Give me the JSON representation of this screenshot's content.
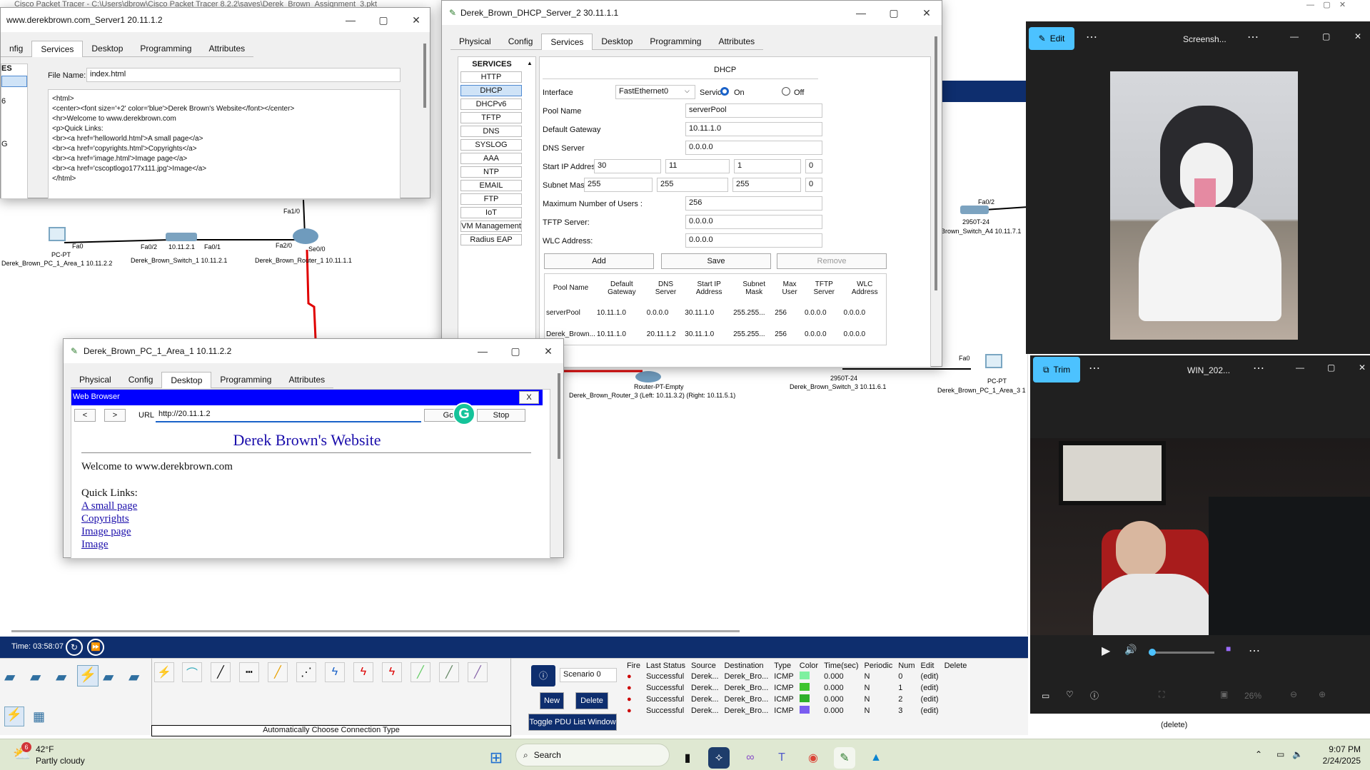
{
  "bg_title": "Cisco Packet Tracer - C:\\Users\\dbrow\\Cisco Packet Tracer 8.2.2\\saves\\Derek_Brown_Assignment_3.pkt",
  "server1": {
    "title": "www.derekbrown.com_Server1 20.11.1.2",
    "tabs": [
      "nfig",
      "Services",
      "Desktop",
      "Programming",
      "Attributes"
    ],
    "side_head": "ES",
    "file_label": "File Name:",
    "file_value": "index.html",
    "code": [
      "<html>",
      "<center><font size='+2' color='blue'>Derek Brown's Website</font></center>",
      "<hr>Welcome to www.derekbrown.com",
      "<p>Quick Links:",
      "<br><a href='helloworld.html'>A small page</a>",
      "<br><a href='copyrights.html'>Copyrights</a>",
      "<br><a href='image.html'>Image page</a>",
      "<br><a href='cscoptlogo177x111.jpg'>Image</a>",
      "</html>"
    ],
    "side_items": [
      "",
      "6",
      "",
      "G"
    ]
  },
  "dhcp": {
    "title": "Derek_Brown_DHCP_Server_2 30.11.1.1",
    "tabs": [
      "Physical",
      "Config",
      "Services",
      "Desktop",
      "Programming",
      "Attributes"
    ],
    "services_head": "SERVICES",
    "services": [
      "HTTP",
      "DHCP",
      "DHCPv6",
      "TFTP",
      "DNS",
      "SYSLOG",
      "AAA",
      "NTP",
      "EMAIL",
      "FTP",
      "IoT",
      "VM Management",
      "Radius EAP"
    ],
    "heading": "DHCP",
    "interface_label": "Interface",
    "interface_value": "FastEthernet0",
    "service_label": "Service",
    "on": "On",
    "off": "Off",
    "pool_label": "Pool Name",
    "pool_value": "serverPool",
    "gw_label": "Default Gateway",
    "gw_value": "10.11.1.0",
    "dns_label": "DNS Server",
    "dns_value": "0.0.0.0",
    "start_label": "Start IP Address :",
    "start_ip": [
      "30",
      "11",
      "1",
      "0"
    ],
    "mask_label": "Subnet Mask:",
    "mask": [
      "255",
      "255",
      "255",
      "0"
    ],
    "max_label": "Maximum Number of Users :",
    "max_value": "256",
    "tftp_label": "TFTP Server:",
    "tftp_value": "0.0.0.0",
    "wlc_label": "WLC Address:",
    "wlc_value": "0.0.0.0",
    "add": "Add",
    "save": "Save",
    "remove": "Remove",
    "table_headers": [
      "Pool Name",
      "Default Gateway",
      "DNS Server",
      "Start IP Address",
      "Subnet Mask",
      "Max User",
      "TFTP Server",
      "WLC Address"
    ],
    "rows": [
      [
        "serverPool",
        "10.11.1.0",
        "0.0.0.0",
        "30.11.1.0",
        "255.255...",
        "256",
        "0.0.0.0",
        "0.0.0.0"
      ],
      [
        "Derek_Brown...",
        "10.11.1.0",
        "20.11.1.2",
        "30.11.1.0",
        "255.255...",
        "256",
        "0.0.0.0",
        "0.0.0.0"
      ]
    ]
  },
  "pc": {
    "title": "Derek_Brown_PC_1_Area_1 10.11.2.2",
    "tabs": [
      "Physical",
      "Config",
      "Desktop",
      "Programming",
      "Attributes"
    ],
    "browser_title": "Web Browser",
    "close": "X",
    "back": "<",
    "fwd": ">",
    "url_label": "URL",
    "url": "http://20.11.1.2",
    "go": "Go",
    "stop": "Stop",
    "page_title": "Derek Brown's Website",
    "welcome": "Welcome to www.derekbrown.com",
    "quick": "Quick Links:",
    "links": [
      "A small page",
      "Copyrights",
      "Image page",
      "Image"
    ]
  },
  "topology": {
    "nodes": [
      {
        "t": "Fa1/0"
      },
      {
        "t": "Fa0"
      },
      {
        "t": "Fa0/2"
      },
      {
        "t": "Fa0/1"
      },
      {
        "t": "10.11.2.1"
      },
      {
        "t": "Fa2/0"
      },
      {
        "t": "Se0/0"
      },
      {
        "t": "PC-PT"
      },
      {
        "t": "Derek_Brown_PC_1_Area_1 10.11.2.2"
      },
      {
        "t": "Derek_Brown_Switch_1 10.11.2.1"
      },
      {
        "t": "Derek_Brown_Router_1 10.11.1.1"
      },
      {
        "t": "Fa0/2"
      },
      {
        "t": "2950T-24"
      },
      {
        "t": "Brown_Switch_A4 10.11.7.1"
      },
      {
        "t": "Router-PT-Empty"
      },
      {
        "t": "Derek_Brown_Router_3 (Left: 10.11.3.2) (Right: 10.11.5.1)"
      },
      {
        "t": "2950T-24"
      },
      {
        "t": "Derek_Brown_Switch_3 10.11.6.1"
      },
      {
        "t": "Fa0"
      },
      {
        "t": "PC-PT"
      },
      {
        "t": "Derek_Brown_PC_1_Area_3 1"
      }
    ]
  },
  "photo1": {
    "edit": "Edit",
    "title": "Screensh..."
  },
  "video": {
    "trim": "Trim",
    "title": "WIN_202...",
    "zoom": "26%"
  },
  "pt": {
    "time": "Time: 03:58:07",
    "conn_type": "Automatically Choose Connection Type",
    "scenario": "Scenario 0",
    "new": "New",
    "delete": "Delete",
    "toggle": "Toggle PDU List Window",
    "pdu_headers": [
      "Fire",
      "Last Status",
      "Source",
      "Destination",
      "Type",
      "Color",
      "Time(sec)",
      "Periodic",
      "Num",
      "Edit",
      "Delete"
    ],
    "pdus": [
      {
        "status": "Successful",
        "src": "Derek...",
        "dst": "Derek_Bro...",
        "type": "ICMP",
        "color": "#7ef0a0",
        "time": "0.000",
        "periodic": "N",
        "num": "0",
        "edit": "(edit)"
      },
      {
        "status": "Successful",
        "src": "Derek...",
        "dst": "Derek_Bro...",
        "type": "ICMP",
        "color": "#3ec42e",
        "time": "0.000",
        "periodic": "N",
        "num": "1",
        "edit": "(edit)"
      },
      {
        "status": "Successful",
        "src": "Derek...",
        "dst": "Derek_Bro...",
        "type": "ICMP",
        "color": "#2eb02a",
        "time": "0.000",
        "periodic": "N",
        "num": "2",
        "edit": "(edit)"
      },
      {
        "status": "Successful",
        "src": "Derek...",
        "dst": "Derek_Bro...",
        "type": "ICMP",
        "color": "#7a5cf0",
        "time": "0.000",
        "periodic": "N",
        "num": "3",
        "edit": "(edit)"
      }
    ],
    "delete_bottom": "(delete)"
  },
  "taskbar": {
    "temp": "42°F",
    "weather": "Partly cloudy",
    "badge": "6",
    "search": "Search",
    "time": "9:07 PM",
    "date": "2/24/2025"
  }
}
